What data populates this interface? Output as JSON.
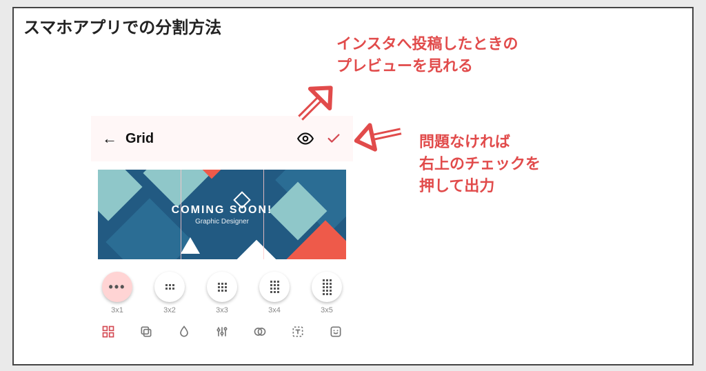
{
  "docTitle": "スマホアプリでの分割方法",
  "phone": {
    "back": "←",
    "title": "Grid",
    "poster": {
      "heading": "COMING SOON!",
      "sub": "Graphic Designer"
    },
    "options": [
      {
        "label": "3x1",
        "selected": true,
        "rows": 1,
        "cols": 3
      },
      {
        "label": "3x2",
        "selected": false,
        "rows": 2,
        "cols": 3
      },
      {
        "label": "3x3",
        "selected": false,
        "rows": 3,
        "cols": 3
      },
      {
        "label": "3x4",
        "selected": false,
        "rows": 4,
        "cols": 3
      },
      {
        "label": "3x5",
        "selected": false,
        "rows": 5,
        "cols": 3
      }
    ],
    "iconbar": [
      "grid",
      "copy",
      "drop",
      "sliders",
      "mask",
      "text",
      "sticker"
    ]
  },
  "annotations": {
    "preview": "インスタへ投稿したときの\nプレビューを見れる",
    "confirm": "問題なければ\n右上のチェックを\n押して出力"
  }
}
